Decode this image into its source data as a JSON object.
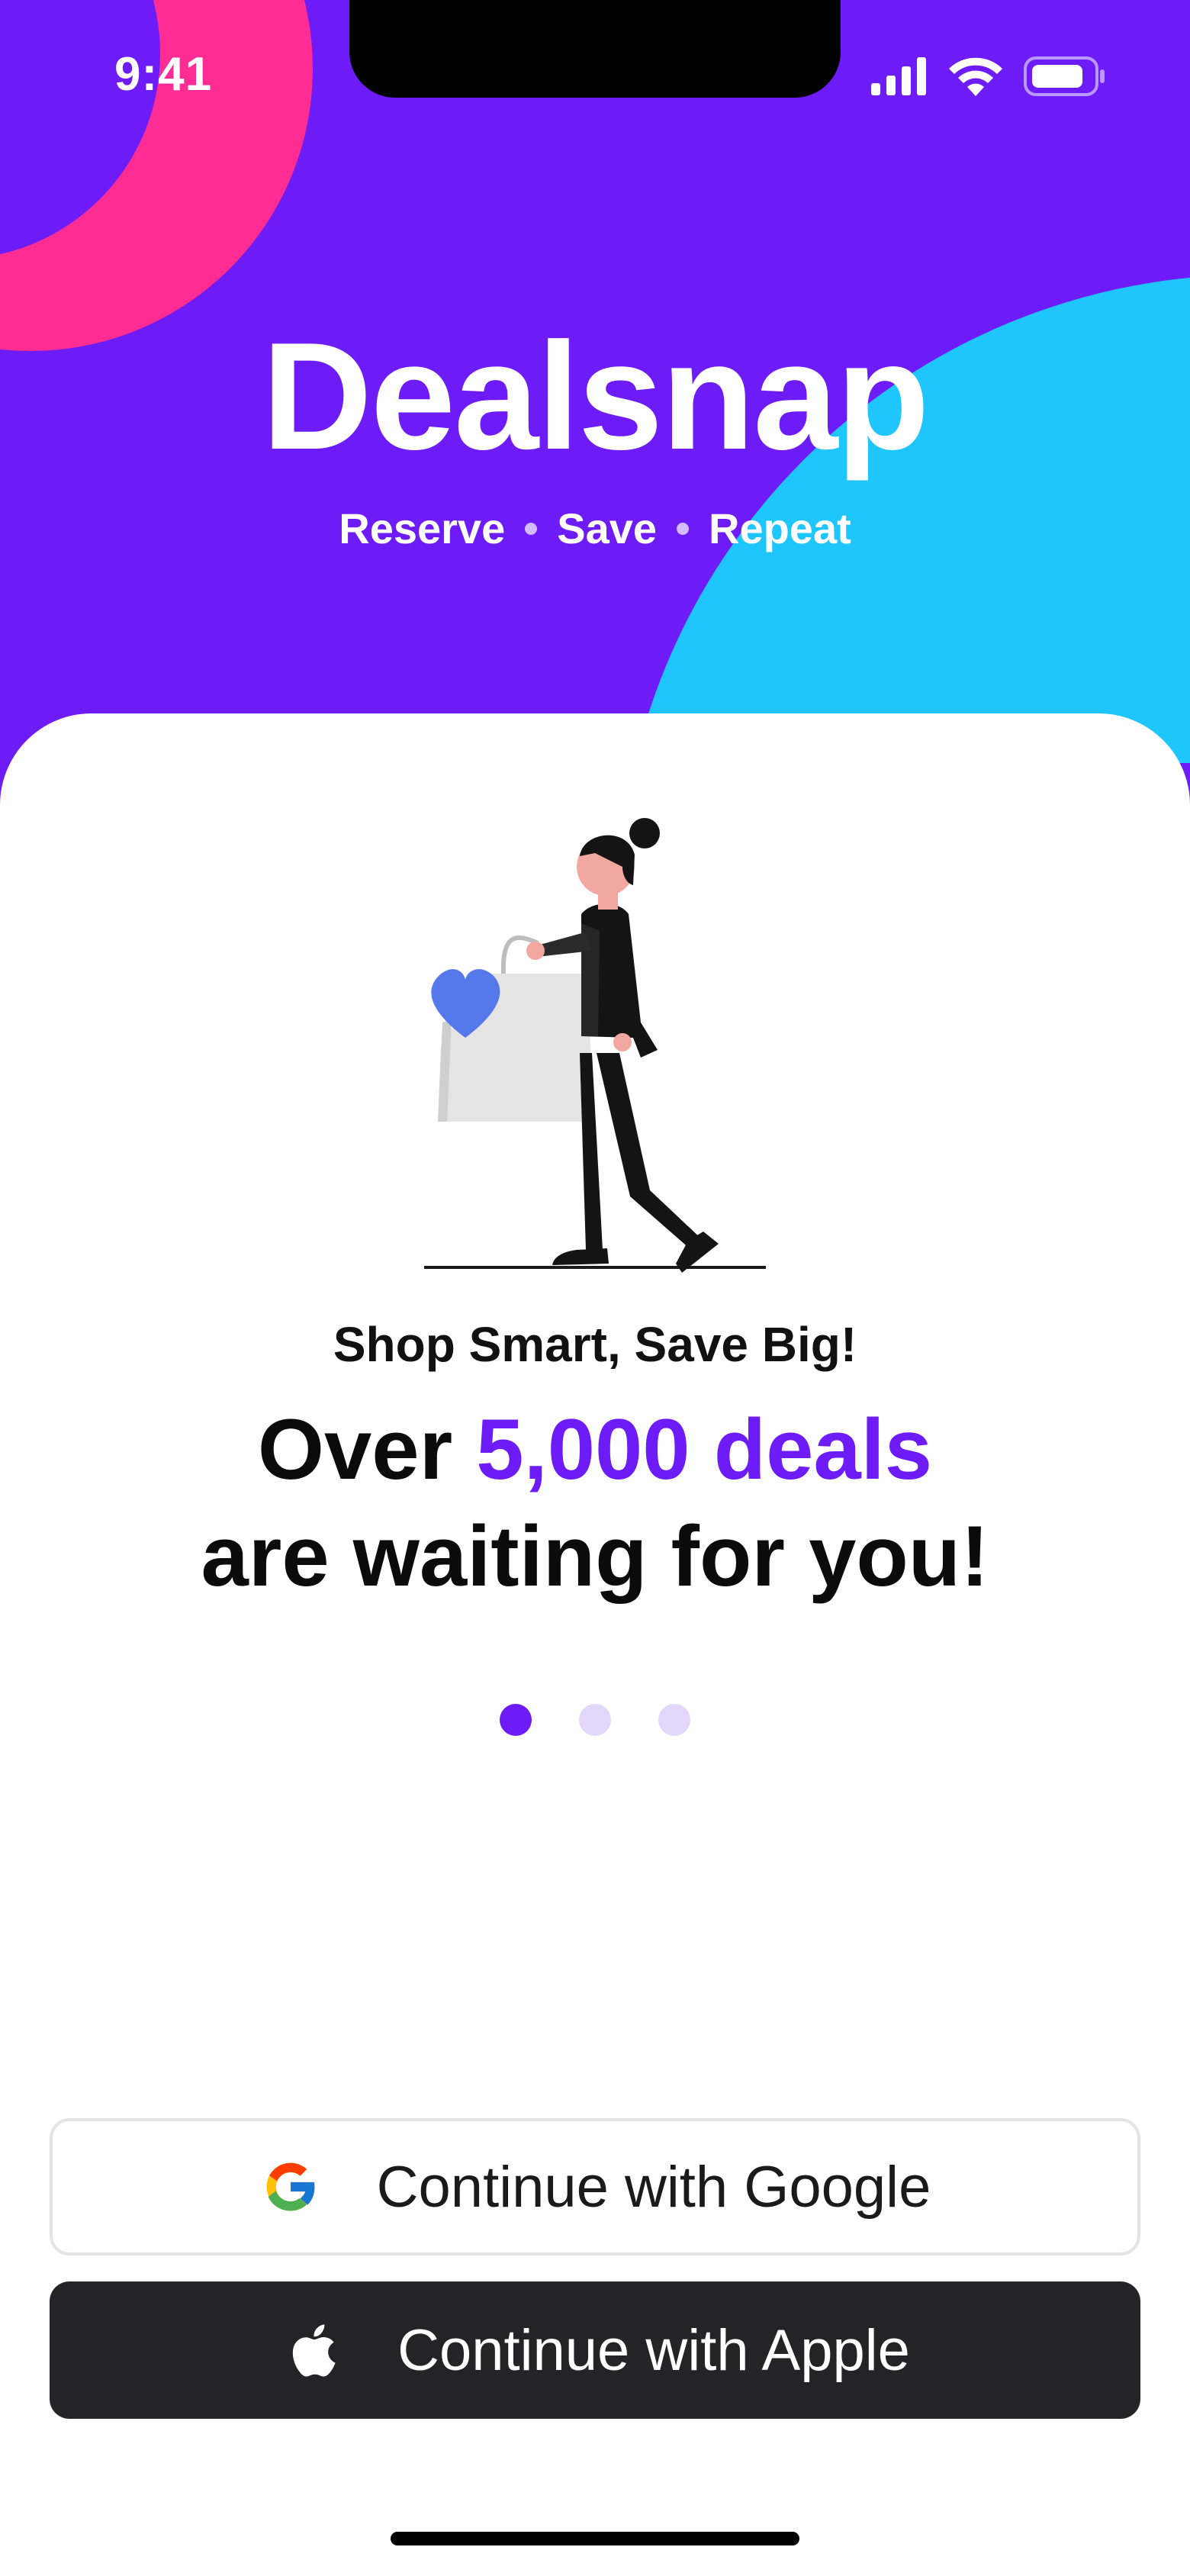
{
  "status_bar": {
    "time": "9:41",
    "signal_icon": "cellular-signal-icon",
    "wifi_icon": "wifi-icon",
    "battery_icon": "battery-icon"
  },
  "brand": {
    "title": "Dealsnap",
    "tagline": [
      "Reserve",
      "Save",
      "Repeat"
    ]
  },
  "onboarding": {
    "illustration": "woman-with-shopping-bag-illustration",
    "subhead": "Shop Smart, Save Big!",
    "headline_prefix": "Over ",
    "headline_highlight": "5,000 deals",
    "headline_line2": "are waiting for you!",
    "pager": {
      "pages": 3,
      "active_index": 0
    }
  },
  "auth": {
    "google_label": "Continue with Google",
    "google_icon": "google-icon",
    "apple_label": "Continue with Apple",
    "apple_icon": "apple-icon"
  },
  "colors": {
    "primary": "#6D1CF8",
    "accent_pink": "#FF2C93",
    "accent_cyan": "#1EC6FD",
    "pager_inactive": "#E3D6FB",
    "apple_button_bg": "#242426"
  }
}
